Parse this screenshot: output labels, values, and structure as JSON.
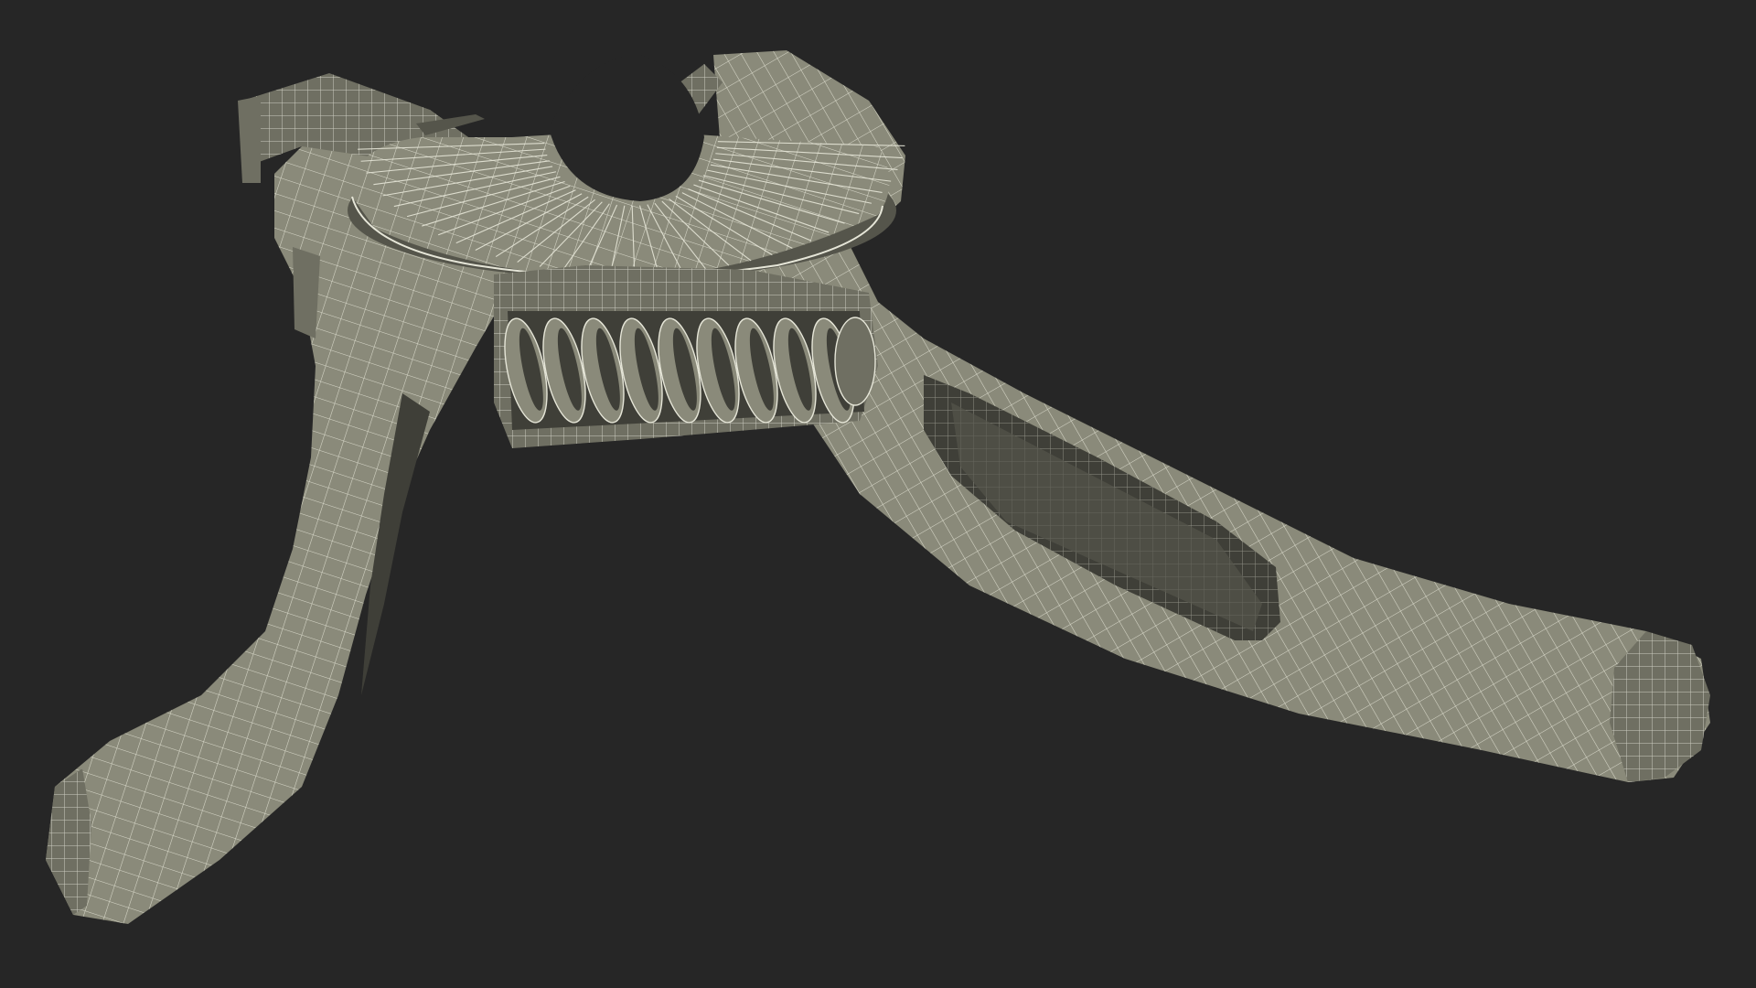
{
  "scene": {
    "subject": "wireframe-spring-clamp",
    "colors": {
      "background": "#262626",
      "surface": "#8a8a7a",
      "surface_shade": "#6f6f62",
      "surface_dark": "#55554b",
      "cavity": "#3f3f38",
      "wire": "#e6e6d8"
    }
  }
}
